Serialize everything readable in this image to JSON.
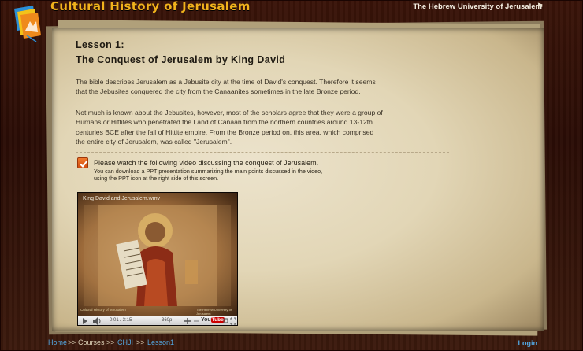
{
  "header": {
    "site_title": "Cultural History of Jerusalem",
    "university": "The Hebrew University of Jerusalem"
  },
  "lesson": {
    "number": "Lesson 1:",
    "title": "The Conquest of Jerusalem by King David",
    "paragraph1_line1": "The bible describes Jerusalem as a Jebusite city at the time of David's conquest. Therefore it seems",
    "paragraph1_line2": "that the Jebusites conquered the city from the Canaanites sometimes in the late Bronze period.",
    "paragraph2_line1": "Not much is known about the Jebusites, however, most of the scholars agree that they  were a group of",
    "paragraph2_line2": "Hurrians or Hittites who penetrated the Land of Canaan from the northern countries around 13-12th",
    "paragraph2_line3": "centuries BCE after the fall of Hittite empire. From the Bronze period on, this area, which comprised",
    "paragraph2_line4": "the entire city of Jerusalem, was called \"Jerusalem\".",
    "video_note": "Please watch the following video discussing the conquest of Jerusalem.",
    "video_sub1": "You can download a PPT presentation summarizing the main points discussed in the video,",
    "video_sub2": "using the PPT icon at the right side of this screen."
  },
  "video": {
    "name": "King David and Jerusalem.wmv",
    "caption_left": "Cultural History of Jerusalem",
    "caption_right": "The Hebrew University of Jerusalem",
    "time": "0:01 / 3:15",
    "quality": "360p",
    "brand_you": "You",
    "brand_tube": "Tube"
  },
  "footer": {
    "breadcrumb": [
      {
        "label": "Home",
        "link": true
      },
      {
        "label": ">> Courses >>",
        "link": false
      },
      {
        "label": "CHJI",
        "link": true
      },
      {
        "label": ">>",
        "link": false
      },
      {
        "label": "Lesson1",
        "link": true
      }
    ],
    "login": "Login"
  },
  "colors": {
    "title_gold": "#f2b21c",
    "link_blue": "#52a6df",
    "checkbox_orange": "#e8621e"
  }
}
